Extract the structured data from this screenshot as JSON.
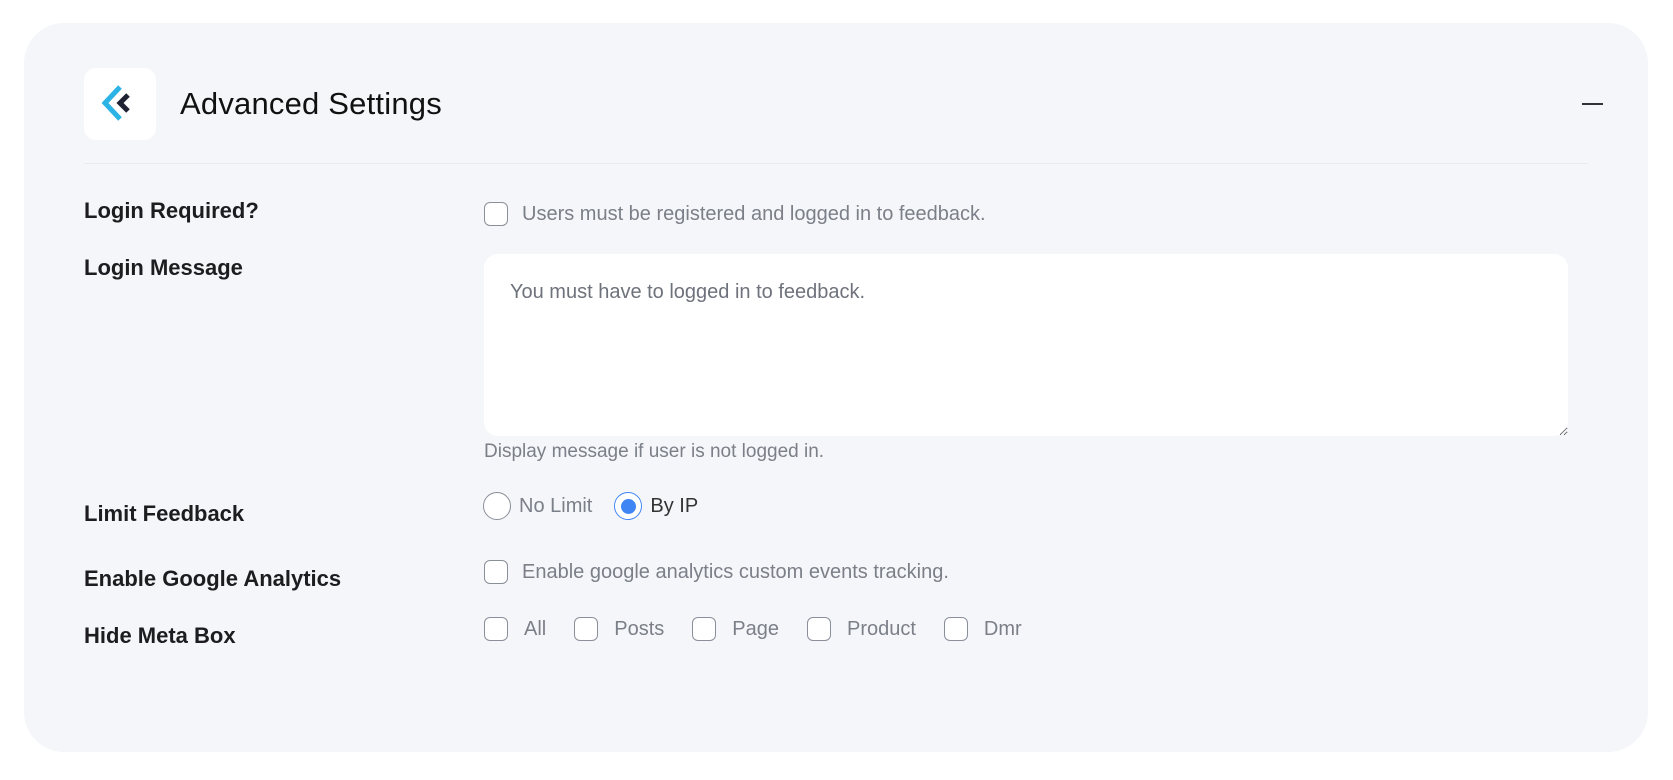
{
  "panel": {
    "title": "Advanced Settings",
    "logo_icon": "brand-chevron-logo",
    "collapse_icon": "minus-icon",
    "colors": {
      "card_background": "#f5f6fa",
      "accent": "#3f86f4",
      "logo_cyan": "#2bb3e6",
      "logo_dark": "#1f2233"
    }
  },
  "settings": {
    "login_required": {
      "label": "Login Required?",
      "checkbox_text": "Users must be registered and logged in to feedback.",
      "checked": false
    },
    "login_message": {
      "label": "Login Message",
      "value": "You must have to logged in to feedback.",
      "helper": "Display message if user is not logged in."
    },
    "limit_feedback": {
      "label": "Limit Feedback",
      "options": [
        {
          "label": "No Limit",
          "selected": false
        },
        {
          "label": "By IP",
          "selected": true
        }
      ]
    },
    "google_analytics": {
      "label": "Enable Google Analytics",
      "checkbox_text": "Enable google analytics custom events tracking.",
      "checked": false
    },
    "hide_meta_box": {
      "label": "Hide Meta Box",
      "options": [
        {
          "label": "All",
          "checked": false
        },
        {
          "label": "Posts",
          "checked": false
        },
        {
          "label": "Page",
          "checked": false
        },
        {
          "label": "Product",
          "checked": false
        },
        {
          "label": "Dmr",
          "checked": false
        }
      ]
    }
  }
}
